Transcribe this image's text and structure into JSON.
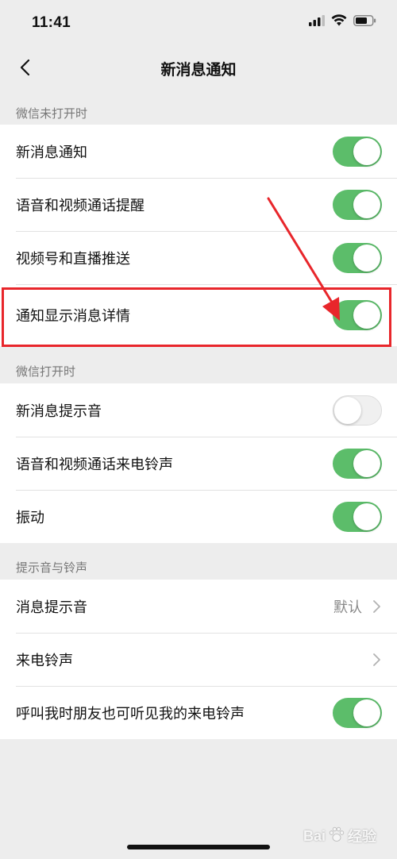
{
  "status_bar": {
    "time": "11:41",
    "icons": [
      "signal-icon",
      "wifi-icon",
      "battery-icon"
    ]
  },
  "nav": {
    "title": "新消息通知",
    "back_icon": "chevron-left-icon"
  },
  "sections": [
    {
      "header": "微信未打开时",
      "rows": [
        {
          "label": "新消息通知",
          "toggle": true
        },
        {
          "label": "语音和视频通话提醒",
          "toggle": true
        },
        {
          "label": "视频号和直播推送",
          "toggle": true
        },
        {
          "label": "通知显示消息详情",
          "toggle": true,
          "highlighted": true
        }
      ]
    },
    {
      "header": "微信打开时",
      "rows": [
        {
          "label": "新消息提示音",
          "toggle": false
        },
        {
          "label": "语音和视频通话来电铃声",
          "toggle": true
        },
        {
          "label": "振动",
          "toggle": true
        }
      ]
    },
    {
      "header": "提示音与铃声",
      "rows": [
        {
          "label": "消息提示音",
          "value": "默认",
          "chevron": true
        },
        {
          "label": "来电铃声",
          "chevron": true
        },
        {
          "label": "呼叫我时朋友也可听见我的来电铃声",
          "toggle": true
        }
      ]
    }
  ],
  "watermark": {
    "brand_text": "Bai",
    "suffix_text": "经验"
  },
  "colors": {
    "toggle_on": "#5cbd6a",
    "toggle_off": "#f0f0f0",
    "highlight": "#e8262b",
    "background": "#ededed"
  }
}
